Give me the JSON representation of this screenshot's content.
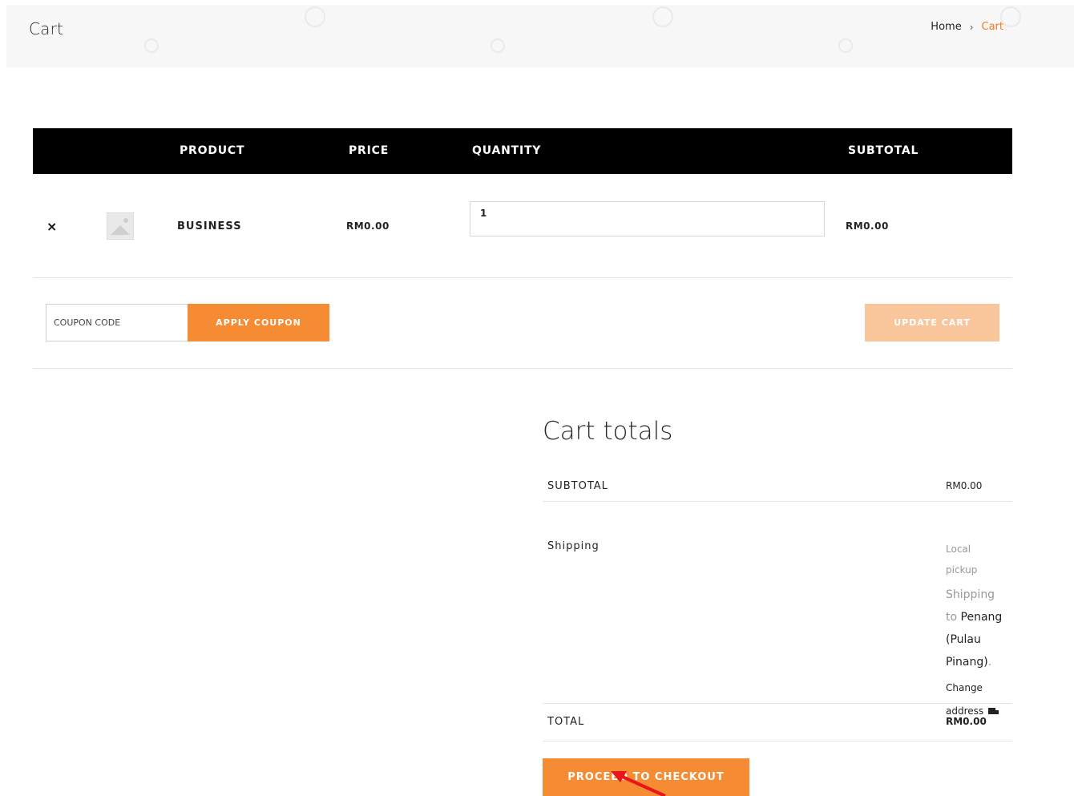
{
  "header": {
    "title": "Cart",
    "breadcrumb": {
      "home": "Home",
      "separator": "›",
      "current": "Cart"
    }
  },
  "cart_table": {
    "columns": {
      "product": "PRODUCT",
      "price": "PRICE",
      "quantity": "QUANTITY",
      "subtotal": "SUBTOTAL"
    },
    "items": [
      {
        "remove": "×",
        "name": "BUSINESS",
        "price": "RM0.00",
        "quantity": "1",
        "subtotal": "RM0.00"
      }
    ]
  },
  "actions": {
    "coupon_placeholder": "COUPON CODE",
    "apply_label": "APPLY COUPON",
    "update_label": "UPDATE CART"
  },
  "totals": {
    "title": "Cart totals",
    "subtotal_label": "SUBTOTAL",
    "subtotal_value": "RM0.00",
    "shipping_label": "Shipping",
    "shipping_method_line1": "Local",
    "shipping_method_line2": "pickup",
    "shipping_to_line1": "Shipping",
    "shipping_to_prefix": "to",
    "shipping_dest_line1": "Penang",
    "shipping_dest_line2": "(Pulau",
    "shipping_dest_line3": "Pinang)",
    "shipping_dest_suffix": ".",
    "change_line1": "Change",
    "change_line2": "address",
    "total_label": "TOTAL",
    "total_value": "RM0.00",
    "checkout_label": "PROCEED TO CHECKOUT"
  },
  "colors": {
    "accent": "#f58b33",
    "accent_light": "#f9c59b",
    "header_bg": "#000000",
    "link_current": "#f47a21"
  }
}
